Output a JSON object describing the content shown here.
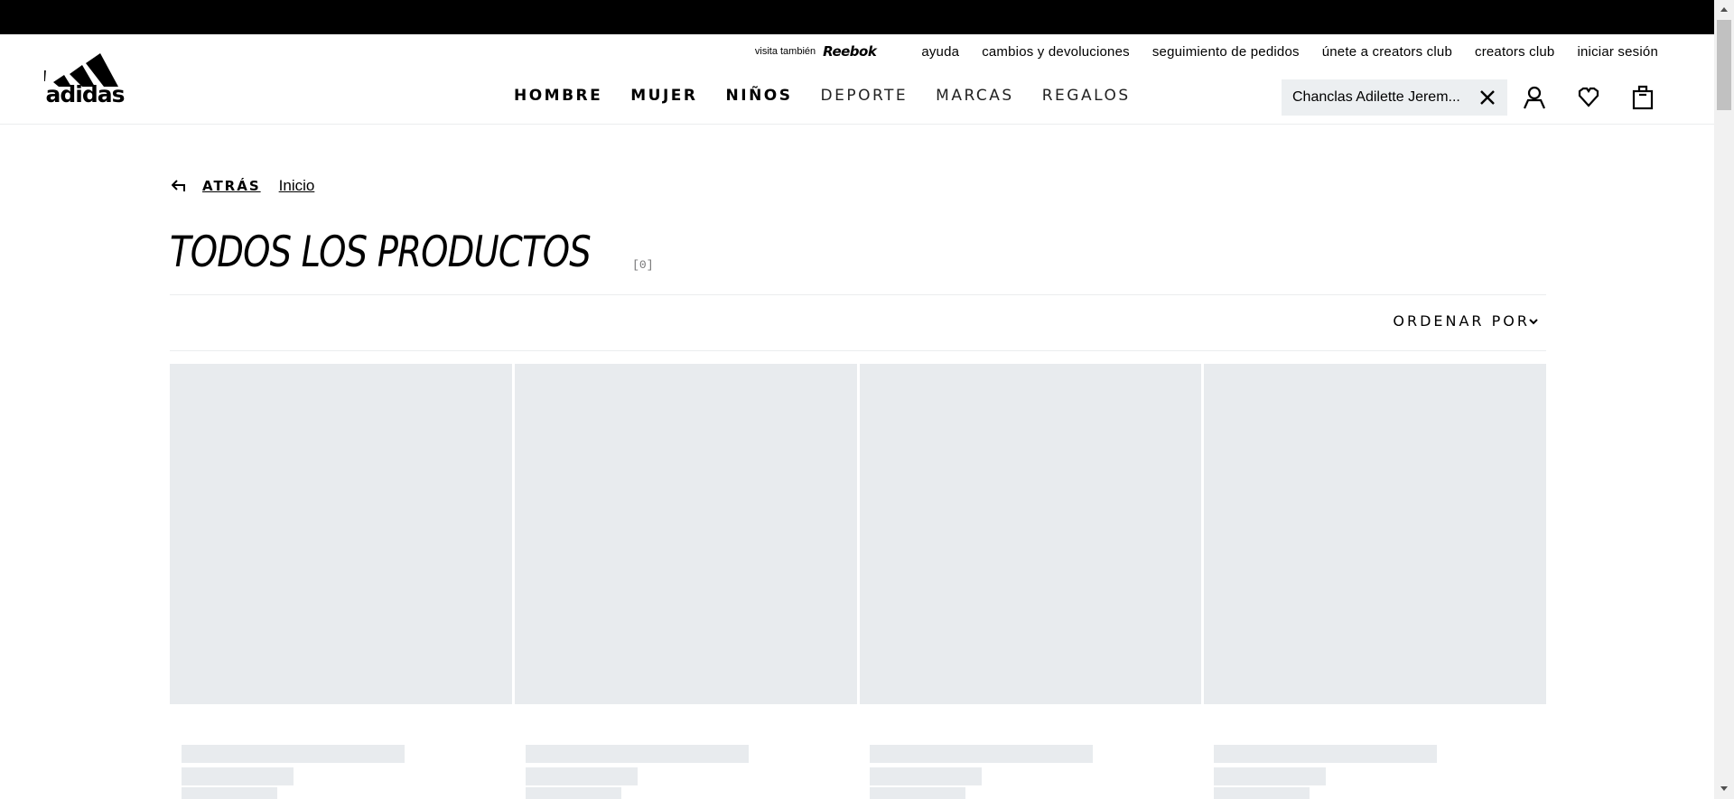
{
  "header": {
    "logo_text": "adidas",
    "utility": {
      "visit_label": "visita también",
      "brand": "Reebok",
      "links": [
        "ayuda",
        "cambios y devoluciones",
        "seguimiento de pedidos",
        "únete a creators club",
        "creators club",
        "iniciar sesión"
      ]
    },
    "nav": [
      "HOMBRE",
      "MUJER",
      "NIÑOS",
      "DEPORTE",
      "MARCAS",
      "REGALOS"
    ],
    "search": {
      "value": "Chanclas Adilette Jerem..."
    },
    "icons": [
      "user-icon",
      "wishlist-heart-icon",
      "shopping-bag-icon"
    ]
  },
  "breadcrumb": {
    "back_label": "ATRÁS",
    "home_label": "Inicio"
  },
  "page": {
    "title": "TODOS LOS PRODUCTOS",
    "count": "[0]"
  },
  "sort": {
    "label": "ORDENAR POR"
  },
  "colors": {
    "skeleton": "#e8ebee",
    "divider": "#ebedee",
    "topbar": "#000000"
  }
}
